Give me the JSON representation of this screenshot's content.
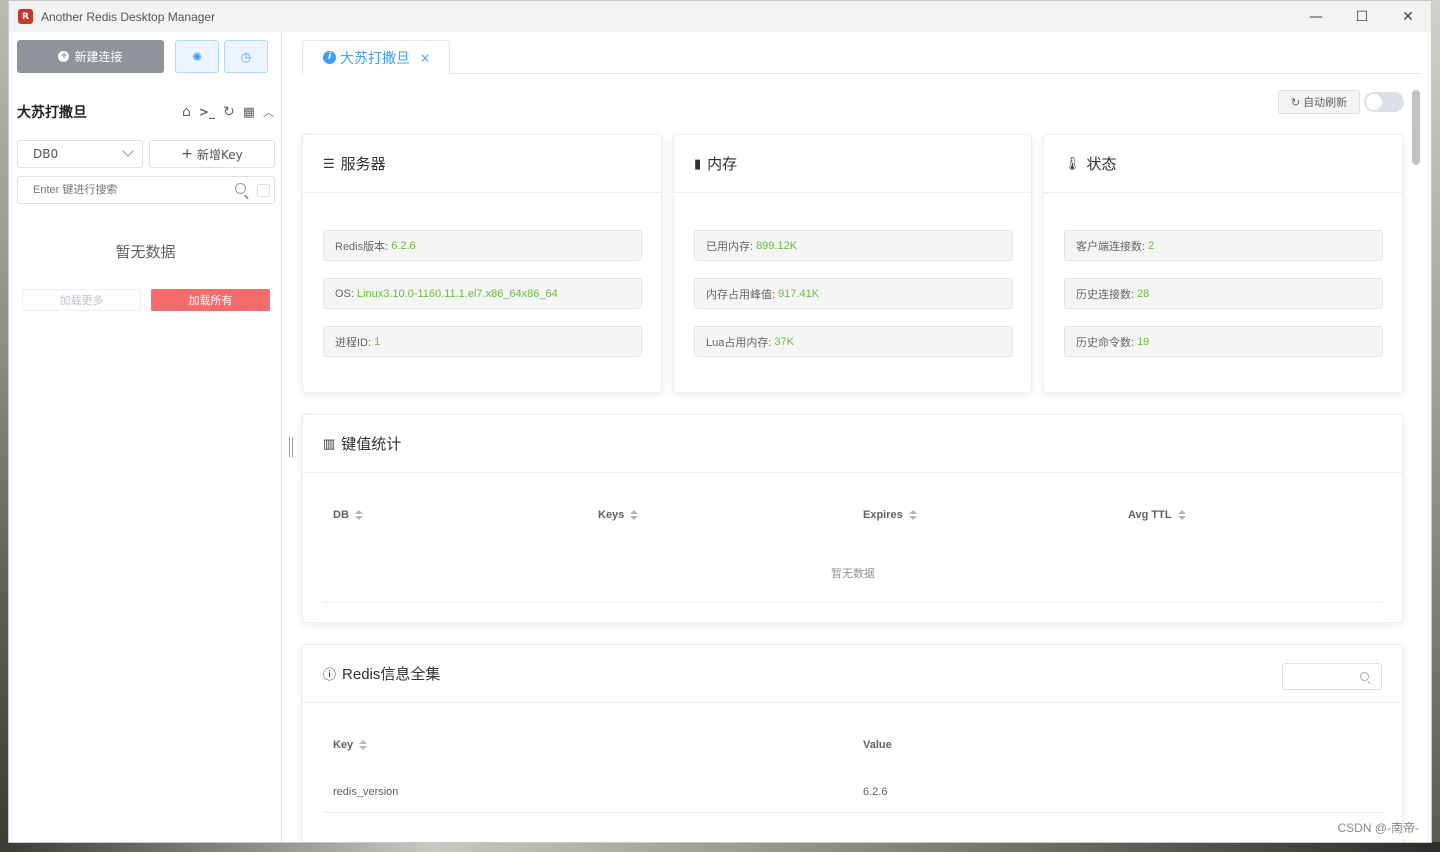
{
  "window": {
    "app_icon_text": "R",
    "title": "Another Redis Desktop Manager",
    "minimize_glyph": "—",
    "maximize_glyph": "☐",
    "close_glyph": "✕"
  },
  "sidebar": {
    "new_connection_label": "新建连接",
    "connection_name": "大苏打撒旦",
    "db_select_value": "DB0",
    "new_key_label": "新增Key",
    "search_placeholder": "Enter 键进行搜索",
    "empty_text": "暂无数据",
    "load_more_label": "加载更多",
    "load_all_label": "加载所有"
  },
  "tab": {
    "label": "大苏打撒旦",
    "close_glyph": "×"
  },
  "toolbar": {
    "auto_refresh_label": "自动刷新",
    "auto_refresh_on": false
  },
  "server_card": {
    "title": "服务器",
    "rows": [
      {
        "label": "Redis版本:",
        "value": "6.2.6"
      },
      {
        "label": "OS:",
        "value": "Linux3.10.0-1160.11.1.el7.x86_64x86_64"
      },
      {
        "label": "进程ID:",
        "value": "1"
      }
    ]
  },
  "memory_card": {
    "title": "内存",
    "rows": [
      {
        "label": "已用内存:",
        "value": "899.12K"
      },
      {
        "label": "内存占用峰值:",
        "value": "917.41K"
      },
      {
        "label": "Lua占用内存:",
        "value": "37K"
      }
    ]
  },
  "status_card": {
    "title": "状态",
    "rows": [
      {
        "label": "客户端连接数:",
        "value": "2"
      },
      {
        "label": "历史连接数:",
        "value": "28"
      },
      {
        "label": "历史命令数:",
        "value": "19"
      }
    ]
  },
  "keystats_card": {
    "title": "键值统计",
    "columns": [
      "DB",
      "Keys",
      "Expires",
      "Avg TTL"
    ],
    "empty_text": "暂无数据"
  },
  "redis_info_card": {
    "title": "Redis信息全集",
    "columns": [
      "Key",
      "Value"
    ],
    "rows": [
      {
        "key": "redis_version",
        "value": "6.2.6"
      }
    ]
  },
  "watermark": "CSDN @-南帝-",
  "colors": {
    "accent": "#409eff",
    "danger": "#f56c6c",
    "value_green": "#67c23a",
    "new_conn_bg": "#909399"
  }
}
